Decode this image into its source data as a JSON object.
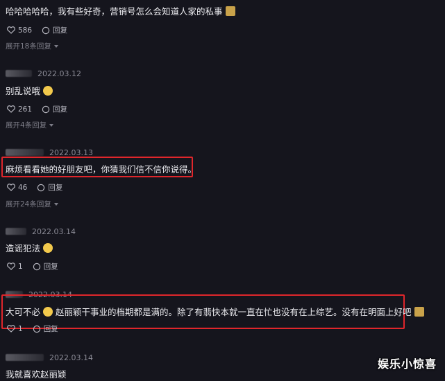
{
  "comments": [
    {
      "author_blurred": false,
      "date": "",
      "text": "哈哈哈哈哈，我有些好奇，营销号怎么会知道人家的私事",
      "emoji": "label-icon",
      "likes": "586",
      "reply_label": "回复",
      "expand": "展开18条回复"
    },
    {
      "author_blurred": true,
      "date": "2022.03.12",
      "text": "别乱说哦",
      "emoji": "face-icon",
      "likes": "261",
      "reply_label": "回复",
      "expand": "展开4条回复"
    },
    {
      "author_blurred": true,
      "date": "2022.03.13",
      "text": "麻烦看看她的好朋友吧，你猜我们信不信你说得。",
      "emoji": "",
      "likes": "46",
      "reply_label": "回复",
      "expand": "展开24条回复"
    },
    {
      "author_blurred": true,
      "date": "2022.03.14",
      "text": "造谣犯法",
      "emoji": "shocked-face-icon",
      "likes": "1",
      "reply_label": "回复",
      "expand": ""
    },
    {
      "author_blurred": true,
      "date": "2022.03.14",
      "text_a": "大可不必",
      "text_b": "赵丽颖干事业的档期都是满的。除了有翡快本就一直在忙也没有在上综艺。没有在明面上好吧",
      "emoji": "laughing-face-icon",
      "likes": "1",
      "reply_label": "回复",
      "expand": ""
    },
    {
      "author_blurred": true,
      "date": "2022.03.14",
      "text": "我就喜欢赵丽颖",
      "emoji": "",
      "likes": "",
      "reply_label": "",
      "expand": ""
    }
  ],
  "watermark": "娱乐小惊喜",
  "colors": {
    "background": "#15151d",
    "highlight": "#e0262b",
    "text": "#ececf0",
    "muted": "#8b8b96"
  }
}
